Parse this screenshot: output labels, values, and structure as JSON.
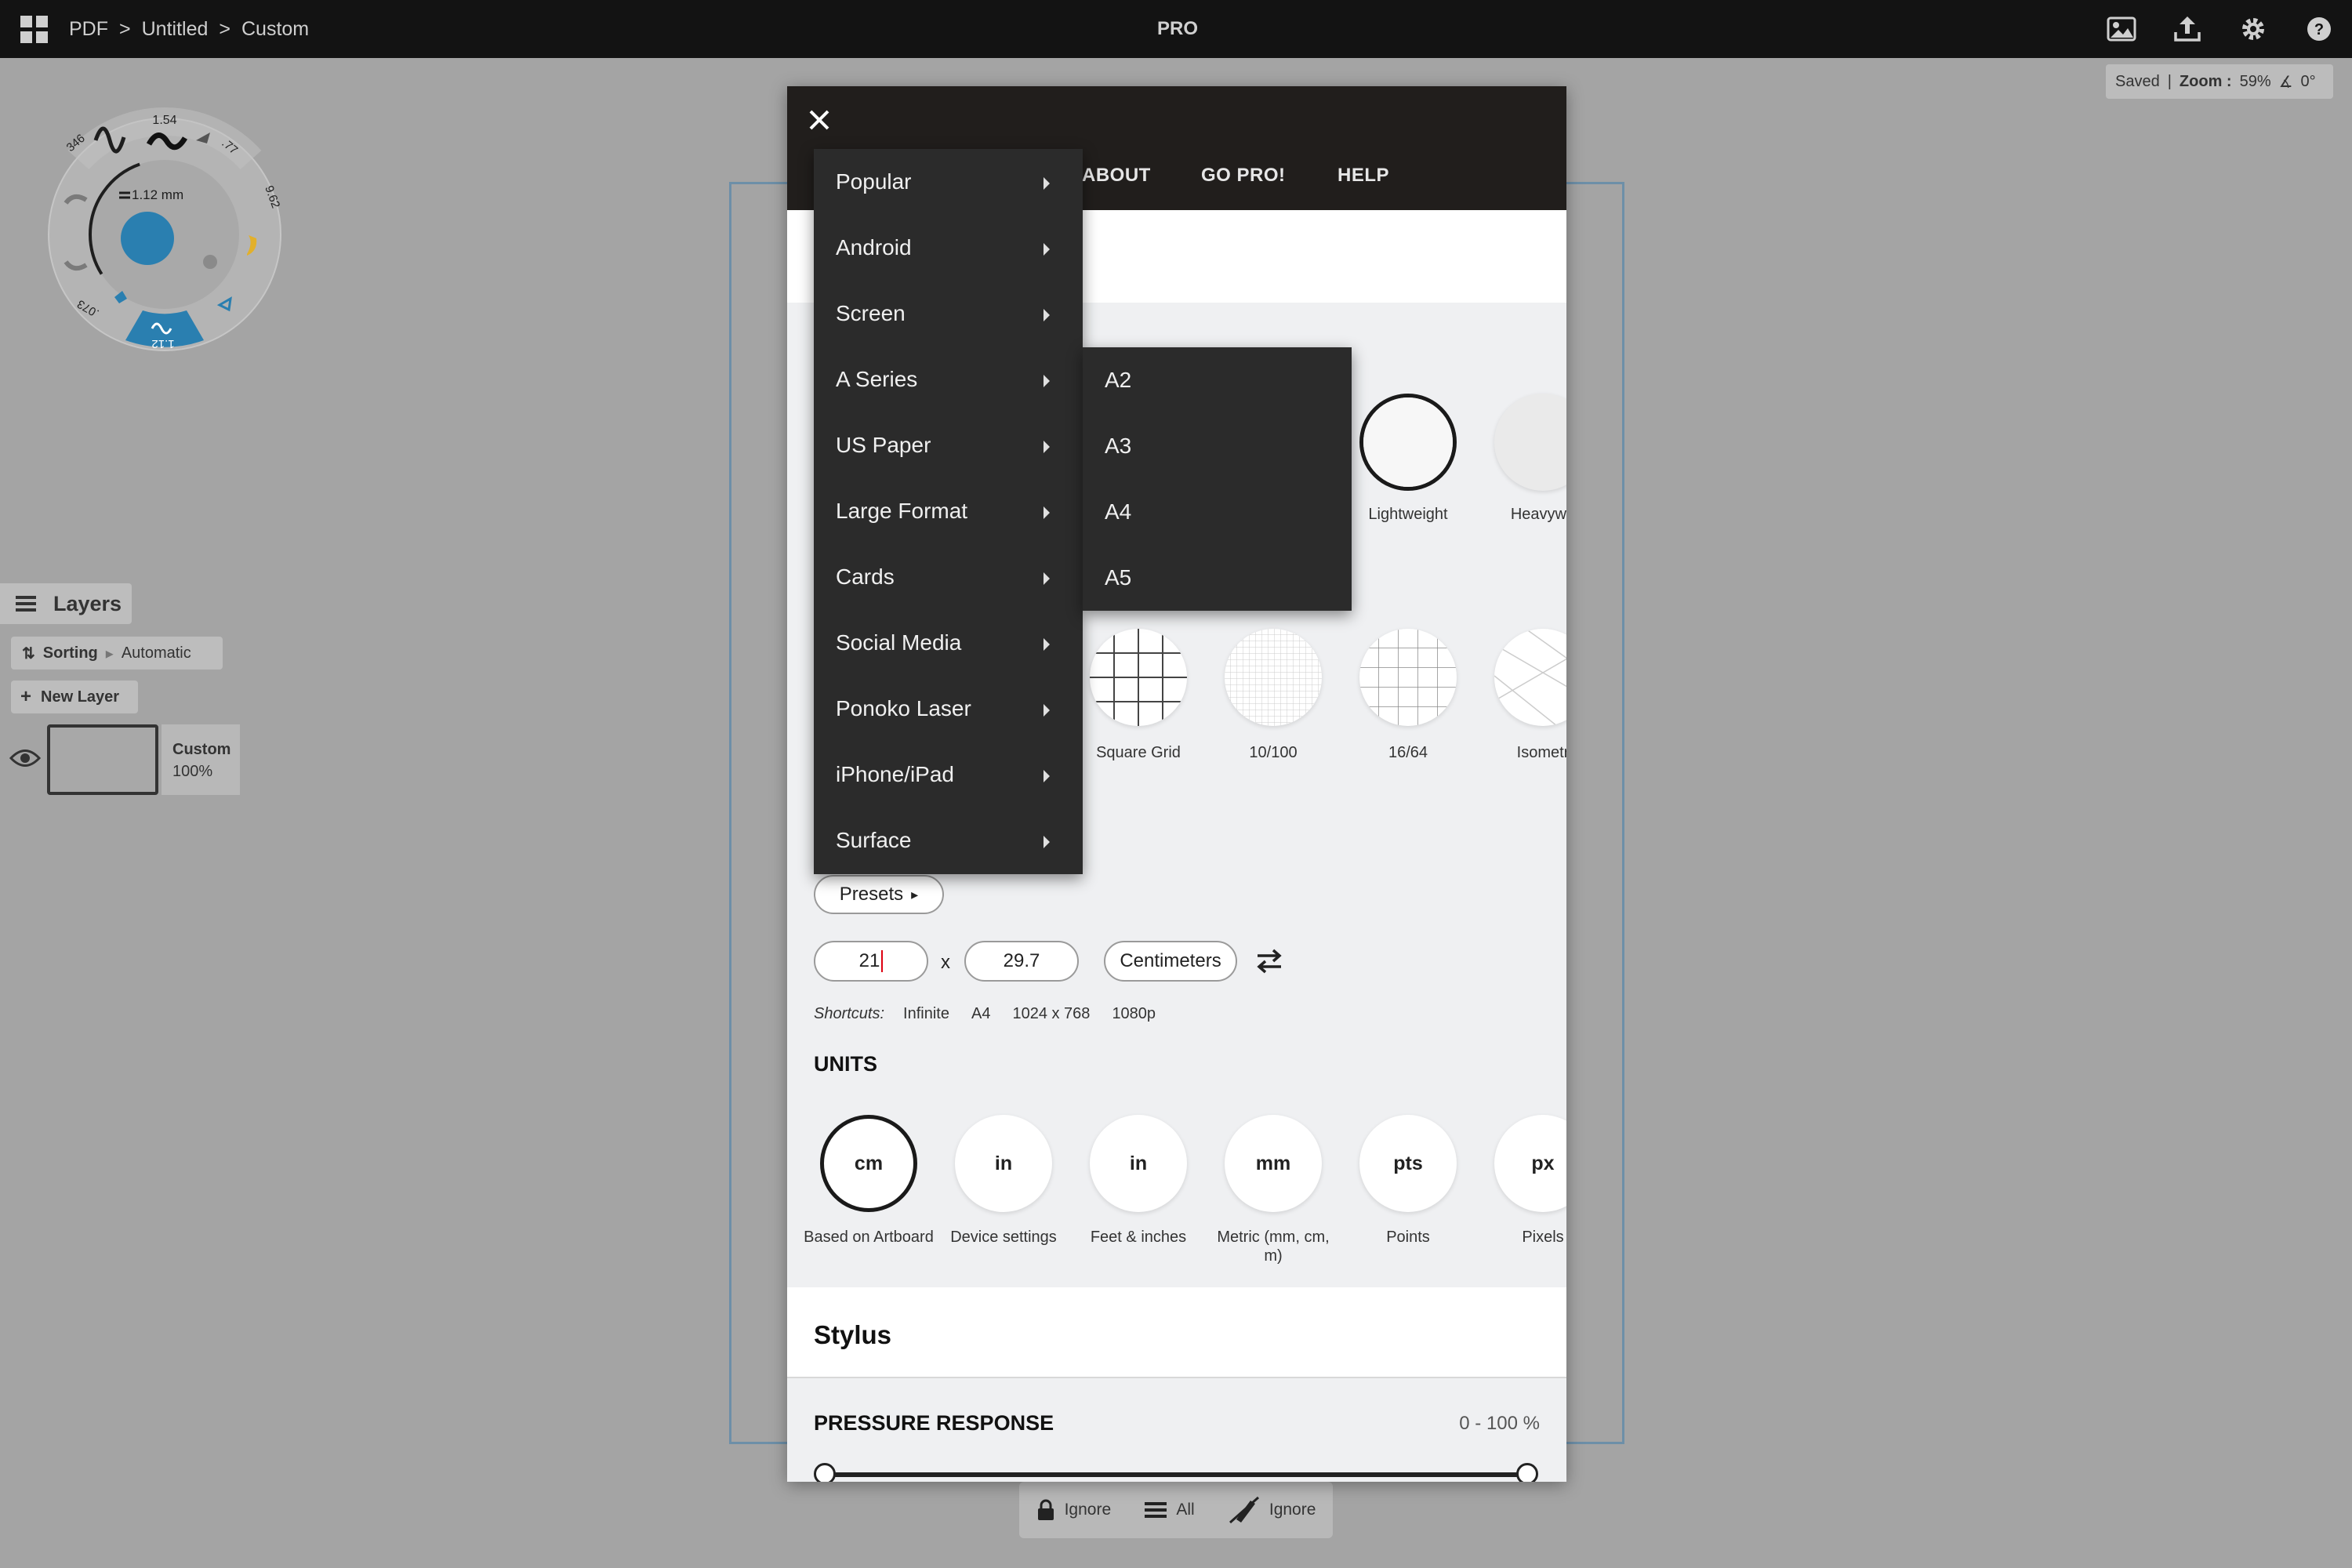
{
  "topbar": {
    "breadcrumb": [
      "PDF",
      ">",
      "Untitled",
      ">",
      "Custom"
    ],
    "title": "PRO",
    "icons": [
      "grid-icon",
      "image-icon",
      "upload-icon",
      "gear-icon",
      "help-icon"
    ]
  },
  "status": {
    "saved": "Saved",
    "separator": "|",
    "zoom_label": "Zoom :",
    "zoom_value": "59%",
    "rotation": "0°"
  },
  "brush_wheel": {
    "size_top": "1.54",
    "left_value": "346",
    "right_top": ".77",
    "right_value": "9.62",
    "center_size": "1.12 mm",
    "bottom_left": ".073",
    "bottom_value": "1.12",
    "accent_color": "#2a7fb0",
    "yellow_color": "#e2b02b"
  },
  "layers": {
    "title": "Layers",
    "sorting_label": "Sorting",
    "sorting_value": "Automatic",
    "new_layer": "New Layer",
    "items": [
      {
        "name": "Custom",
        "opacity": "100%"
      }
    ]
  },
  "bottom_toolbar": {
    "lock": "Ignore",
    "layers": "All",
    "stylus": "Ignore"
  },
  "dialog": {
    "tabs": [
      "ABOUT",
      "GO PRO!",
      "HELP"
    ],
    "paper_types": [
      {
        "label": "Lightweight",
        "selected": true
      },
      {
        "label": "Heavywe",
        "selected": false
      }
    ],
    "grids": [
      {
        "label": "Square Grid"
      },
      {
        "label": "10/100"
      },
      {
        "label": "16/64"
      },
      {
        "label": "Isometr"
      }
    ],
    "presets_button": "Presets",
    "width": "21",
    "times": "x",
    "height": "29.7",
    "unit_select": "Centimeters",
    "shortcuts_label": "Shortcuts:",
    "shortcuts": [
      "Infinite",
      "A4",
      "1024 x 768",
      "1080p"
    ],
    "units_heading": "UNITS",
    "units": [
      {
        "abbr": "cm",
        "label": "Based on Artboard",
        "selected": true
      },
      {
        "abbr": "in",
        "label": "Device settings",
        "selected": false
      },
      {
        "abbr": "in",
        "label": "Feet & inches",
        "selected": false
      },
      {
        "abbr": "mm",
        "label": "Metric (mm, cm, m)",
        "selected": false
      },
      {
        "abbr": "pts",
        "label": "Points",
        "selected": false
      },
      {
        "abbr": "px",
        "label": "Pixels",
        "selected": false
      }
    ],
    "stylus_heading": "Stylus",
    "pressure_heading": "PRESSURE RESPONSE",
    "pressure_value": "0 - 100 %",
    "pressure_range": [
      0,
      100
    ]
  },
  "presets_menu": {
    "items": [
      "Popular",
      "Android",
      "Screen",
      "A Series",
      "US Paper",
      "Large Format",
      "Cards",
      "Social Media",
      "Ponoko Laser",
      "iPhone/iPad",
      "Surface"
    ],
    "active": "A Series",
    "submenu": [
      "A2",
      "A3",
      "A4",
      "A5"
    ]
  }
}
